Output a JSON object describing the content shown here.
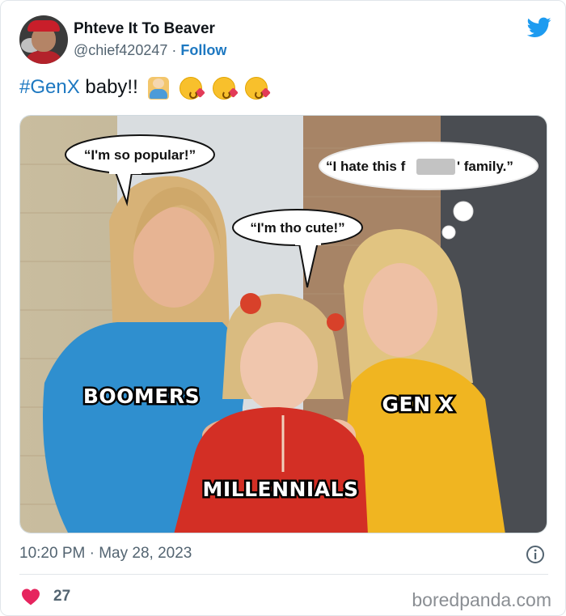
{
  "user": {
    "display_name": "Phteve It To Beaver",
    "handle": "@chief420247",
    "separator": " · ",
    "follow_label": "Follow"
  },
  "tweet": {
    "hashtag": "#GenX",
    "text": " baby!!",
    "emoji_names": [
      "man-mechanic-emoji",
      "face-blowing-kiss-emoji",
      "face-blowing-kiss-emoji",
      "face-blowing-kiss-emoji"
    ]
  },
  "meme": {
    "bubble_left": "“I'm so popular!”",
    "bubble_middle": "“I'm tho cute!”",
    "bubble_right": "“I hate this f",
    "bubble_right_end": "' family.”",
    "caption_left": "BOOMERS",
    "caption_middle": "MILLENNIALS",
    "caption_right": "GEN X"
  },
  "footer": {
    "timestamp": "10:20 PM · May 28, 2023",
    "like_count": "27",
    "watermark": "boredpanda.com"
  },
  "colors": {
    "link_blue": "#1d78c1",
    "twitter_blue": "#1d9bf0",
    "heart_pink": "#e6245e",
    "muted_text": "#536471"
  },
  "icons": [
    "twitter-bird-icon",
    "info-icon",
    "heart-icon"
  ]
}
